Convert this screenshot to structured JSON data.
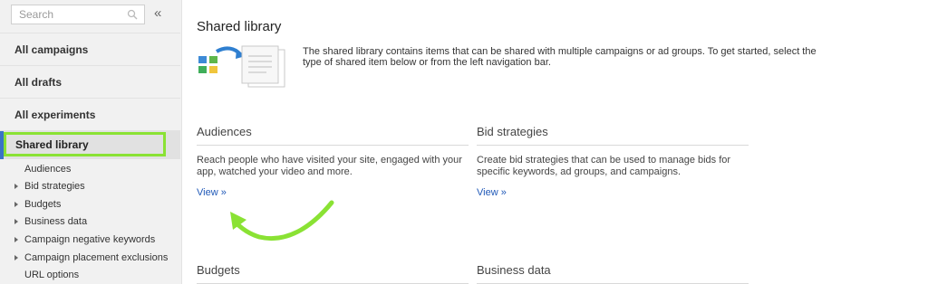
{
  "sidebar": {
    "search": {
      "placeholder": "Search"
    },
    "collapse_glyph": "«",
    "items": [
      {
        "label": "All campaigns"
      },
      {
        "label": "All drafts"
      },
      {
        "label": "All experiments"
      }
    ],
    "active_item": {
      "label": "Shared library"
    },
    "sub_items": [
      {
        "label": "Audiences"
      },
      {
        "label": "Bid strategies"
      },
      {
        "label": "Budgets"
      },
      {
        "label": "Business data"
      },
      {
        "label": "Campaign negative keywords"
      },
      {
        "label": "Campaign placement exclusions"
      },
      {
        "label": "URL options"
      }
    ]
  },
  "main": {
    "title": "Shared library",
    "intro": "The shared library contains items that can be shared with multiple campaigns or ad groups. To get started, select the type of shared item below or from the left navigation bar.",
    "cards": [
      {
        "title": "Audiences",
        "description": "Reach people who have visited your site, engaged with your app, watched your video and more.",
        "link": "View »"
      },
      {
        "title": "Bid strategies",
        "description": "Create bid strategies that can be used to manage bids for specific keywords, ad groups, and campaigns.",
        "link": "View »"
      },
      {
        "title": "Budgets"
      },
      {
        "title": "Business data"
      }
    ]
  },
  "colors": {
    "highlight": "#8ae234",
    "active_bar": "#3a73c7",
    "link": "#2059b8"
  }
}
